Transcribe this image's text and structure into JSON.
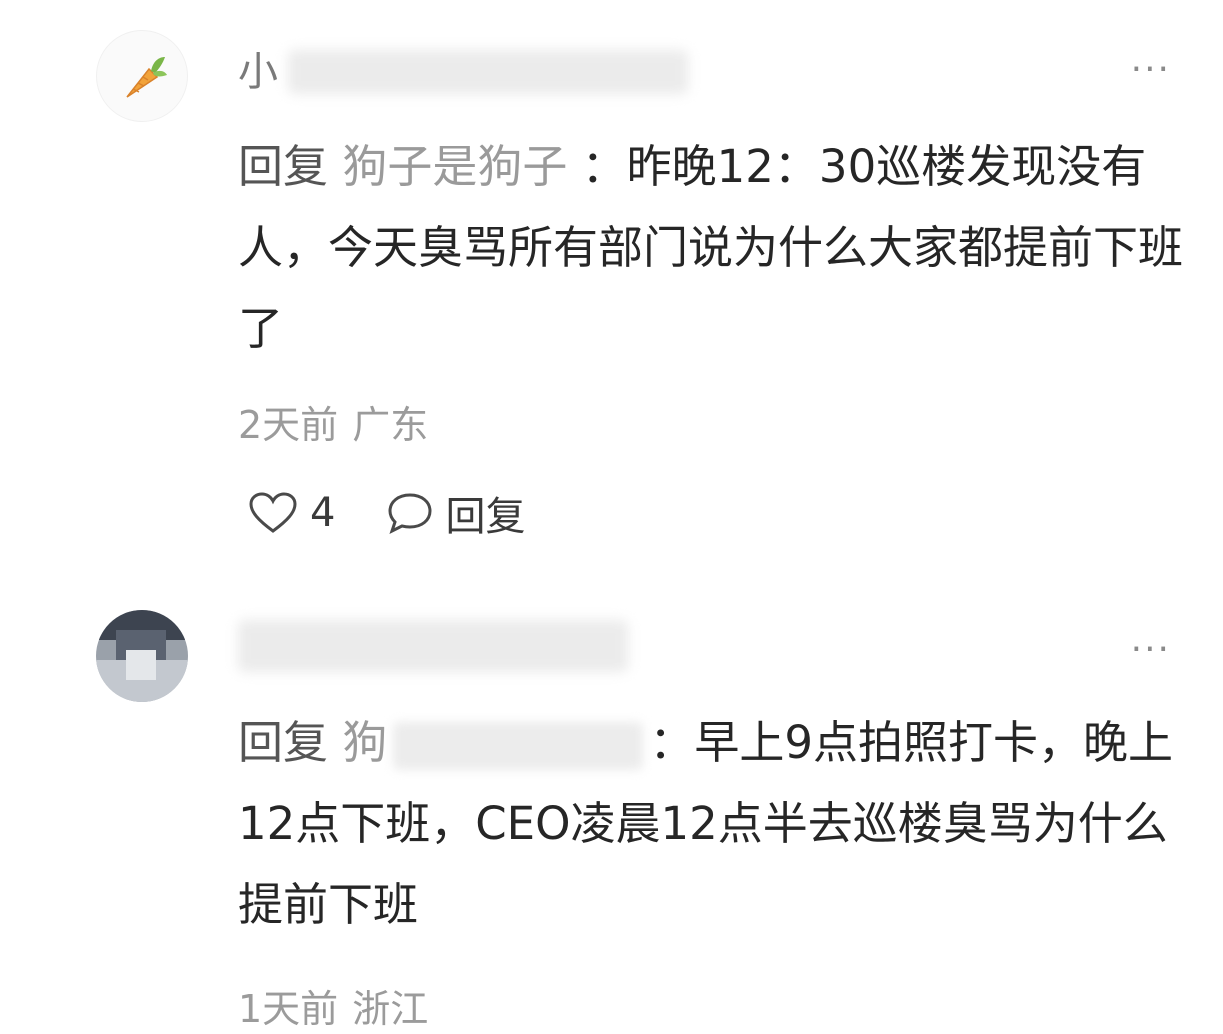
{
  "comments": [
    {
      "username_visible": "小",
      "reply_prefix": "回复",
      "reply_target": "狗子是狗子",
      "reply_separator": "：",
      "text": "昨晚12：30巡楼发现没有人，今天臭骂所有部门说为什么大家都提前下班了",
      "time": "2天前",
      "location": "广东",
      "like_count": "4",
      "reply_label": "回复",
      "more": "···"
    },
    {
      "username_visible": "",
      "reply_prefix": "回复",
      "reply_target": "狗",
      "reply_separator": "：",
      "text": "早上9点拍照打卡，晚上12点下班，CEO凌晨12点半去巡楼臭骂为什么提前下班",
      "time": "1天前",
      "location": "浙江",
      "more": "···"
    }
  ],
  "icons": {
    "avatar_1": "carrot-icon",
    "like": "heart-outline-icon",
    "reply": "speech-bubble-icon",
    "more": "more-dots-icon"
  },
  "colors": {
    "carrot": "#f2a33a",
    "carrot_leaf": "#7ab648",
    "muted_text": "#9b9b9b"
  }
}
